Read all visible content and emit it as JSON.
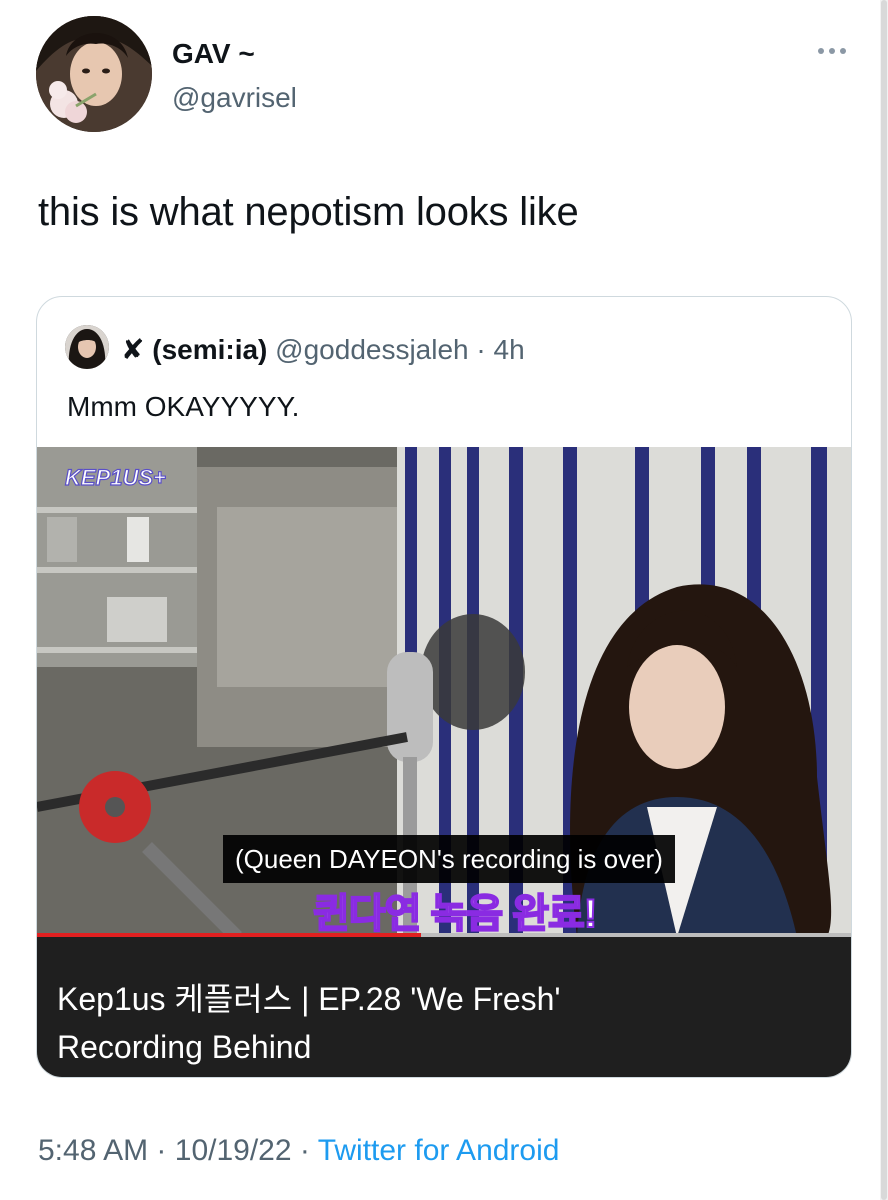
{
  "author": {
    "name": "GAV ~",
    "handle": "@gavrisel"
  },
  "tweet": {
    "text": "this is what nepotism looks like"
  },
  "quoted": {
    "name": "✘ (semi:ia)",
    "handle": "@goddessjaleh",
    "separator": "·",
    "time": "4h",
    "text": "Mmm OKAYYYYY.",
    "video": {
      "logo": "KEP1US+",
      "subtitle_en": "(Queen DAYEON's recording is over)",
      "subtitle_ko": "퀸다연 녹음 완료!",
      "progress": 0.47,
      "title_line1": "Kep1us 케플러스 | EP.28 'We Fresh'",
      "title_line2": "Recording Behind"
    }
  },
  "meta": {
    "time": "5:48 AM",
    "sep1": "·",
    "date": "10/19/22",
    "sep2": "·",
    "source": "Twitter for Android"
  },
  "icons": [
    "more-icon"
  ],
  "colors": {
    "link": "#1d9bf0",
    "secondary_text": "#536471",
    "progress": "#e02020"
  }
}
